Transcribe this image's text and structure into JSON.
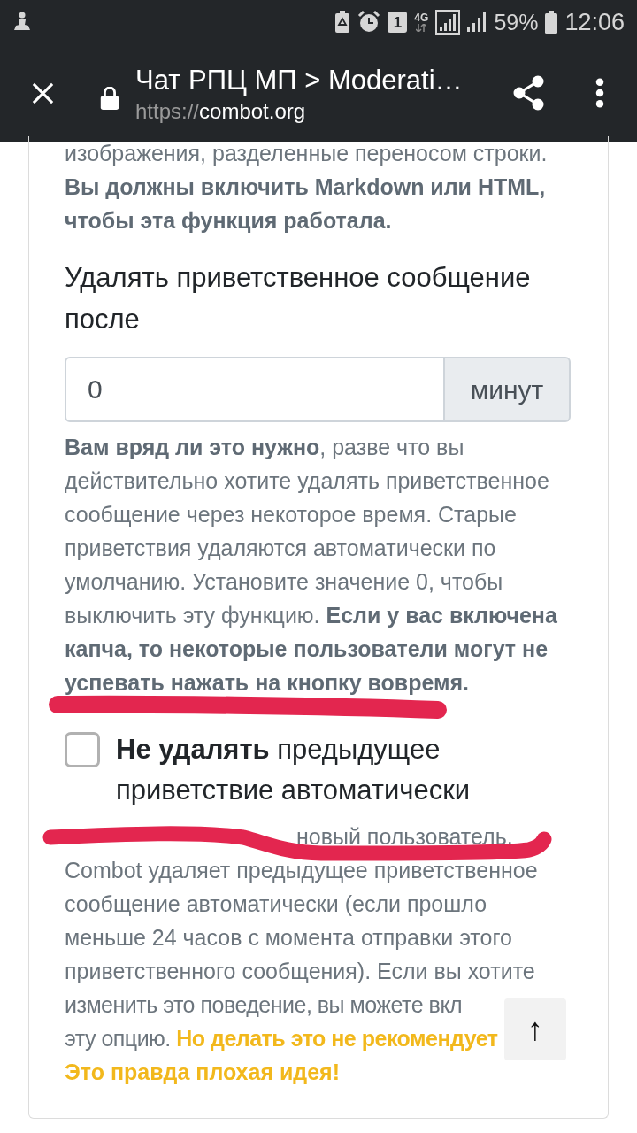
{
  "status_bar": {
    "sim_slot": "1",
    "network_type": "4G",
    "battery": "59%",
    "time": "12:06"
  },
  "toolbar": {
    "title": "Чат РПЦ МП > Moderati…",
    "url_scheme": "https://",
    "url_host": "combot.org"
  },
  "settings": {
    "cut_off_line": "изображения, разделенные переносом строки.",
    "format_note": "Вы должны включить Markdown или HTML, чтобы эта функция работала.",
    "delete_after": {
      "label": "Удалять приветственное сообщение после",
      "value": "0",
      "unit": "минут",
      "help": "**Вам вряд ли это нужно**, разве что вы действительно хотите удалять приветственное сообщение через некоторое время. Старые приветствия удаляются автоматически по умолчанию. Установите значение 0, чтобы выключить эту функцию. **Если у вас включена капча, то некоторые пользователи могут не успевать нажать на кнопку вовремя.**"
    },
    "keep_previous": {
      "checked": false,
      "label": "**Не удалять** предыдущее приветствие автоматически",
      "help_visible_part": "новый пользователь,",
      "help": "Combot удаляет предыдущее приветственное сообщение автоматически (если прошло меньше 24 часов с момента отправки этого приветственного сообщения). Если вы хотите",
      "help_cut_lines": [
        "изменить это поведение, вы можете вкл",
        "эту опцию. **Но делать это не рекомендует**"
      ],
      "warning": "Это правда плохая идея!"
    }
  },
  "scroll_top_button": {
    "label": "↑"
  }
}
